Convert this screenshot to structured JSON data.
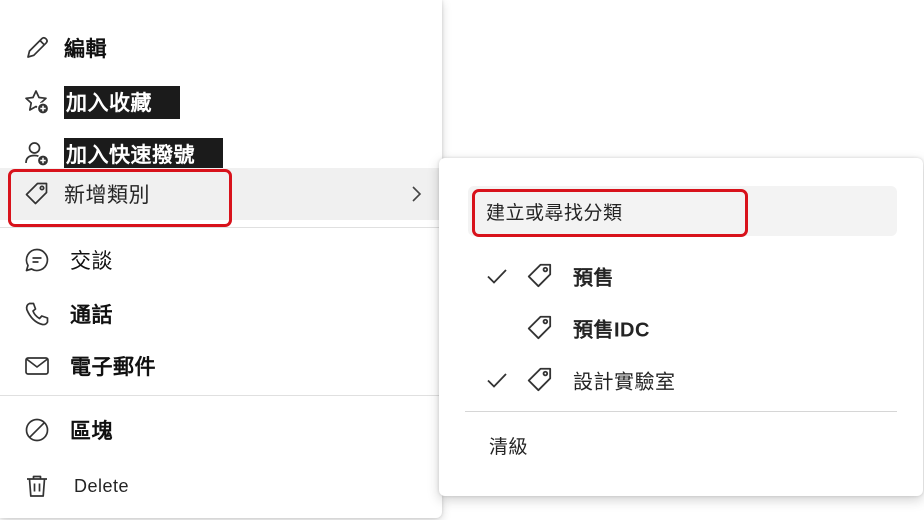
{
  "menu": {
    "items": [
      {
        "id": "edit",
        "label": "編輯",
        "icon": "pencil-icon"
      },
      {
        "id": "favorite",
        "label": "加入收藏",
        "icon": "star-add-icon"
      },
      {
        "id": "speed-dial",
        "label": "加入快速撥號",
        "icon": "person-add-icon"
      },
      {
        "id": "category",
        "label": "新增類別",
        "icon": "tag-icon"
      },
      {
        "id": "chat",
        "label": "交談",
        "icon": "chat-icon"
      },
      {
        "id": "call",
        "label": "通話",
        "icon": "phone-icon"
      },
      {
        "id": "email",
        "label": "電子郵件",
        "icon": "mail-icon"
      },
      {
        "id": "block",
        "label": "區塊",
        "icon": "block-icon"
      },
      {
        "id": "delete",
        "label": "Delete",
        "icon": "trash-icon"
      }
    ]
  },
  "submenu": {
    "search_label": "建立或尋找分類",
    "categories": [
      {
        "label": "預售",
        "checked": true
      },
      {
        "label": "預售IDC",
        "checked": false
      },
      {
        "label": "設計實驗室",
        "checked": true
      }
    ],
    "clear_label": "清級"
  },
  "colors": {
    "highlight": "#d8121b",
    "hover": "#f0f0f0"
  }
}
